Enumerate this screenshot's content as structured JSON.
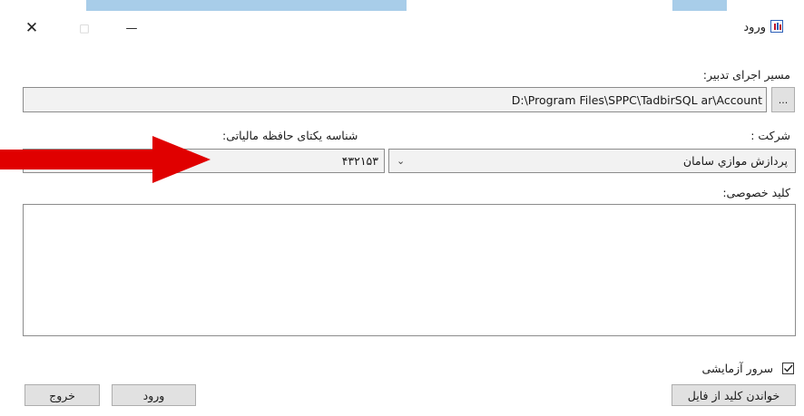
{
  "window": {
    "title": "ورود",
    "close_glyph": "✕",
    "maximize_glyph": "□",
    "minimize_glyph": "—"
  },
  "form": {
    "path_label": "مسیر اجرای تدبیر:",
    "path_value": "D:\\Program Files\\SPPC\\TadbirSQL ar\\Account",
    "browse_label": "...",
    "company_label": "شرکت :",
    "company_value": "پردازش موازي سامان",
    "tax_id_label": "شناسه یکتای حافظه مالیاتی:",
    "tax_id_value": "۴۳۲۱۵۳",
    "private_key_label": "کلید خصوصی:",
    "private_key_value": "",
    "test_server_label": "سرور آزمایشی",
    "test_server_checked": true
  },
  "buttons": {
    "read_key": "خواندن کلید از فایل",
    "login": "ورود",
    "exit": "خروج"
  },
  "colors": {
    "arrow": "#e00000",
    "title_bar_accent": "#a8cde9"
  }
}
